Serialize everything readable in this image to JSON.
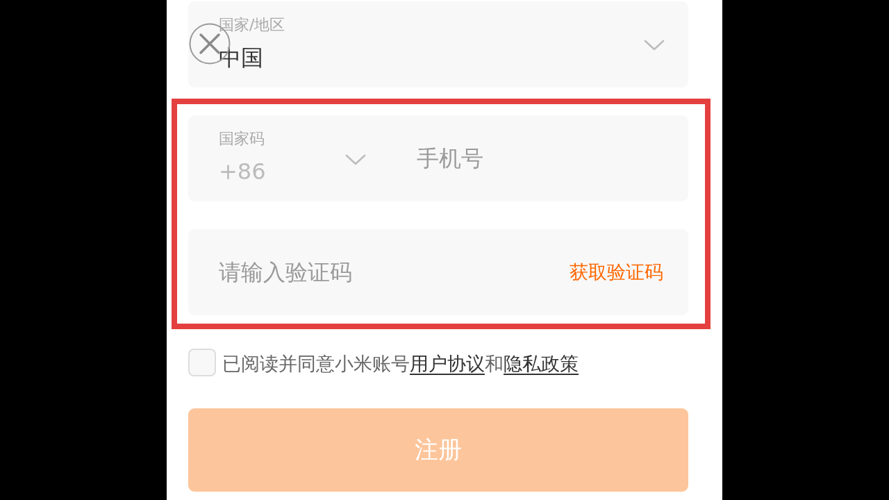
{
  "region_field": {
    "label": "国家/地区",
    "value": "中国"
  },
  "phone_field": {
    "code_label": "国家码",
    "code_value": "+86",
    "placeholder": "手机号"
  },
  "code_field": {
    "placeholder": "请输入验证码",
    "action": "获取验证码"
  },
  "agreement": {
    "checked": false,
    "parts": [
      {
        "kind": "text",
        "text": "已阅读并同意小米账号"
      },
      {
        "kind": "link",
        "text": "用户协议"
      },
      {
        "kind": "text",
        "text": "和"
      },
      {
        "kind": "link",
        "text": "隐私政策"
      }
    ]
  },
  "register_button": {
    "label": "注册",
    "disabled": true
  }
}
